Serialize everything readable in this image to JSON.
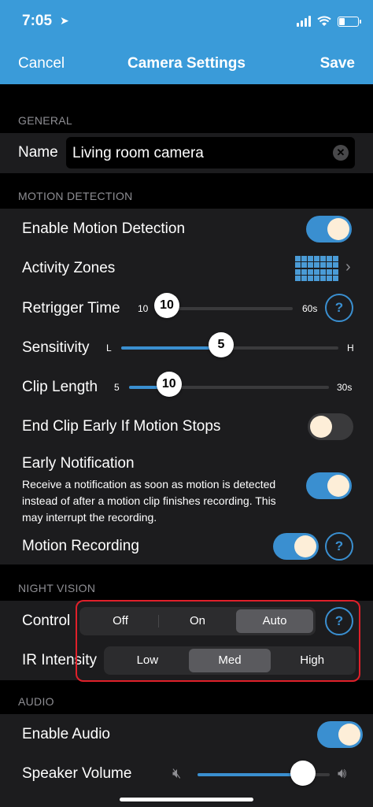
{
  "status": {
    "time": "7:05"
  },
  "nav": {
    "cancel": "Cancel",
    "title": "Camera Settings",
    "save": "Save"
  },
  "general": {
    "header": "GENERAL",
    "name_label": "Name",
    "name_value": "Living room camera"
  },
  "motion": {
    "header": "MOTION DETECTION",
    "enable_label": "Enable Motion Detection",
    "enable_on": true,
    "zones_label": "Activity Zones",
    "retrigger": {
      "label": "Retrigger Time",
      "min": "10",
      "max": "60s",
      "value": "10",
      "fraction": 0.0
    },
    "sensitivity": {
      "label": "Sensitivity",
      "min": "L",
      "max": "H",
      "value": "5",
      "fraction": 0.46
    },
    "clip": {
      "label": "Clip Length",
      "min": "5",
      "max": "30s",
      "value": "10",
      "fraction": 0.2
    },
    "end_clip_label": "End Clip Early If Motion Stops",
    "end_clip_on": false,
    "early_label": "Early Notification",
    "early_desc": "Receive a notification as soon as motion is detected instead of after a motion clip finishes recording. This may interrupt the recording.",
    "early_on": true,
    "recording_label": "Motion Recording",
    "recording_on": true
  },
  "night": {
    "header": "NIGHT VISION",
    "control_label": "Control",
    "control_options": [
      "Off",
      "On",
      "Auto"
    ],
    "control_selected": "Auto",
    "ir_label": "IR Intensity",
    "ir_options": [
      "Low",
      "Med",
      "High"
    ],
    "ir_selected": "Med"
  },
  "audio": {
    "header": "AUDIO",
    "enable_label": "Enable Audio",
    "enable_on": true,
    "volume_label": "Speaker Volume",
    "volume_fraction": 0.8
  },
  "help_symbol": "?",
  "colors": {
    "accent": "#3a9bd9",
    "toggle_on": "#3a8fd0",
    "outline": "#e0202a"
  }
}
